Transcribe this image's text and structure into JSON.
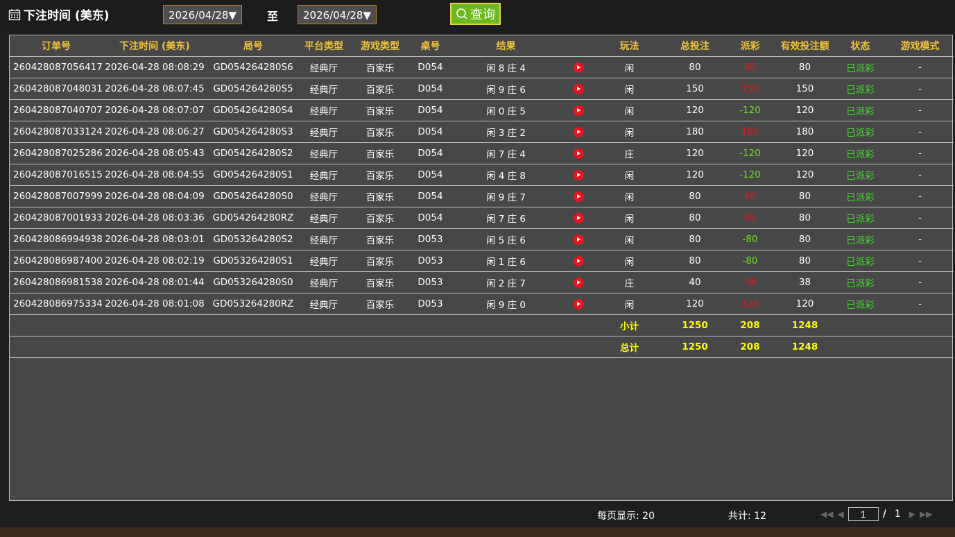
{
  "header": {
    "title": "下注时间 (美东)",
    "start_date": "2026/04/28▼",
    "to_label": "至",
    "end_date": "2026/04/28▼",
    "query_label": "查询"
  },
  "table": {
    "columns": [
      "订单号",
      "下注时间 (美东)",
      "局号",
      "平台类型",
      "游戏类型",
      "桌号",
      "结果",
      "",
      "玩法",
      "总投注",
      "派彩",
      "有效投注额",
      "状态",
      "游戏模式"
    ],
    "rows": [
      {
        "order": "260428087056417",
        "time": "2026-04-28 08:08:29",
        "round": "GD054264280S6",
        "platform": "经典厅",
        "game": "百家乐",
        "table": "D054",
        "result": "闲 8 庄 4",
        "play": "闲",
        "bet": "80",
        "payout": "80",
        "payout_color": "red",
        "valid": "80",
        "status": "已派彩",
        "mode": "-"
      },
      {
        "order": "260428087048031",
        "time": "2026-04-28 08:07:45",
        "round": "GD054264280S5",
        "platform": "经典厅",
        "game": "百家乐",
        "table": "D054",
        "result": "闲 9 庄 6",
        "play": "闲",
        "bet": "150",
        "payout": "150",
        "payout_color": "red",
        "valid": "150",
        "status": "已派彩",
        "mode": "-"
      },
      {
        "order": "260428087040707",
        "time": "2026-04-28 08:07:07",
        "round": "GD054264280S4",
        "platform": "经典厅",
        "game": "百家乐",
        "table": "D054",
        "result": "闲 0 庄 5",
        "play": "闲",
        "bet": "120",
        "payout": "-120",
        "payout_color": "green",
        "valid": "120",
        "status": "已派彩",
        "mode": "-"
      },
      {
        "order": "260428087033124",
        "time": "2026-04-28 08:06:27",
        "round": "GD054264280S3",
        "platform": "经典厅",
        "game": "百家乐",
        "table": "D054",
        "result": "闲 3 庄 2",
        "play": "闲",
        "bet": "180",
        "payout": "180",
        "payout_color": "red",
        "valid": "180",
        "status": "已派彩",
        "mode": "-"
      },
      {
        "order": "260428087025286",
        "time": "2026-04-28 08:05:43",
        "round": "GD054264280S2",
        "platform": "经典厅",
        "game": "百家乐",
        "table": "D054",
        "result": "闲 7 庄 4",
        "play": "庄",
        "bet": "120",
        "payout": "-120",
        "payout_color": "green",
        "valid": "120",
        "status": "已派彩",
        "mode": "-"
      },
      {
        "order": "260428087016515",
        "time": "2026-04-28 08:04:55",
        "round": "GD054264280S1",
        "platform": "经典厅",
        "game": "百家乐",
        "table": "D054",
        "result": "闲 4 庄 8",
        "play": "闲",
        "bet": "120",
        "payout": "-120",
        "payout_color": "green",
        "valid": "120",
        "status": "已派彩",
        "mode": "-"
      },
      {
        "order": "260428087007999",
        "time": "2026-04-28 08:04:09",
        "round": "GD054264280S0",
        "platform": "经典厅",
        "game": "百家乐",
        "table": "D054",
        "result": "闲 9 庄 7",
        "play": "闲",
        "bet": "80",
        "payout": "80",
        "payout_color": "red",
        "valid": "80",
        "status": "已派彩",
        "mode": "-"
      },
      {
        "order": "260428087001933",
        "time": "2026-04-28 08:03:36",
        "round": "GD054264280RZ",
        "platform": "经典厅",
        "game": "百家乐",
        "table": "D054",
        "result": "闲 7 庄 6",
        "play": "闲",
        "bet": "80",
        "payout": "80",
        "payout_color": "red",
        "valid": "80",
        "status": "已派彩",
        "mode": "-"
      },
      {
        "order": "260428086994938",
        "time": "2026-04-28 08:03:01",
        "round": "GD053264280S2",
        "platform": "经典厅",
        "game": "百家乐",
        "table": "D053",
        "result": "闲 5 庄 6",
        "play": "闲",
        "bet": "80",
        "payout": "-80",
        "payout_color": "green",
        "valid": "80",
        "status": "已派彩",
        "mode": "-"
      },
      {
        "order": "260428086987400",
        "time": "2026-04-28 08:02:19",
        "round": "GD053264280S1",
        "platform": "经典厅",
        "game": "百家乐",
        "table": "D053",
        "result": "闲 1 庄 6",
        "play": "闲",
        "bet": "80",
        "payout": "-80",
        "payout_color": "green",
        "valid": "80",
        "status": "已派彩",
        "mode": "-"
      },
      {
        "order": "260428086981538",
        "time": "2026-04-28 08:01:44",
        "round": "GD053264280S0",
        "platform": "经典厅",
        "game": "百家乐",
        "table": "D053",
        "result": "闲 2 庄 7",
        "play": "庄",
        "bet": "40",
        "payout": "38",
        "payout_color": "red",
        "valid": "38",
        "status": "已派彩",
        "mode": "-"
      },
      {
        "order": "260428086975334",
        "time": "2026-04-28 08:01:08",
        "round": "GD053264280RZ",
        "platform": "经典厅",
        "game": "百家乐",
        "table": "D053",
        "result": "闲 9 庄 0",
        "play": "闲",
        "bet": "120",
        "payout": "120",
        "payout_color": "red",
        "valid": "120",
        "status": "已派彩",
        "mode": "-"
      }
    ],
    "subtotal": {
      "label": "小计",
      "bet": "1250",
      "payout": "208",
      "valid": "1248"
    },
    "total": {
      "label": "总计",
      "bet": "1250",
      "payout": "208",
      "valid": "1248"
    }
  },
  "footer": {
    "per_page": "每页显示: 20",
    "total_count": "共计: 12",
    "current_page": "1",
    "page_sep": "/",
    "total_pages": "1"
  },
  "colors": {
    "payout_red": "#d21d1d",
    "payout_green": "#6ee21c",
    "status": "#3ee226",
    "header_text": "#f0c23c",
    "summary": "#ffff00"
  }
}
